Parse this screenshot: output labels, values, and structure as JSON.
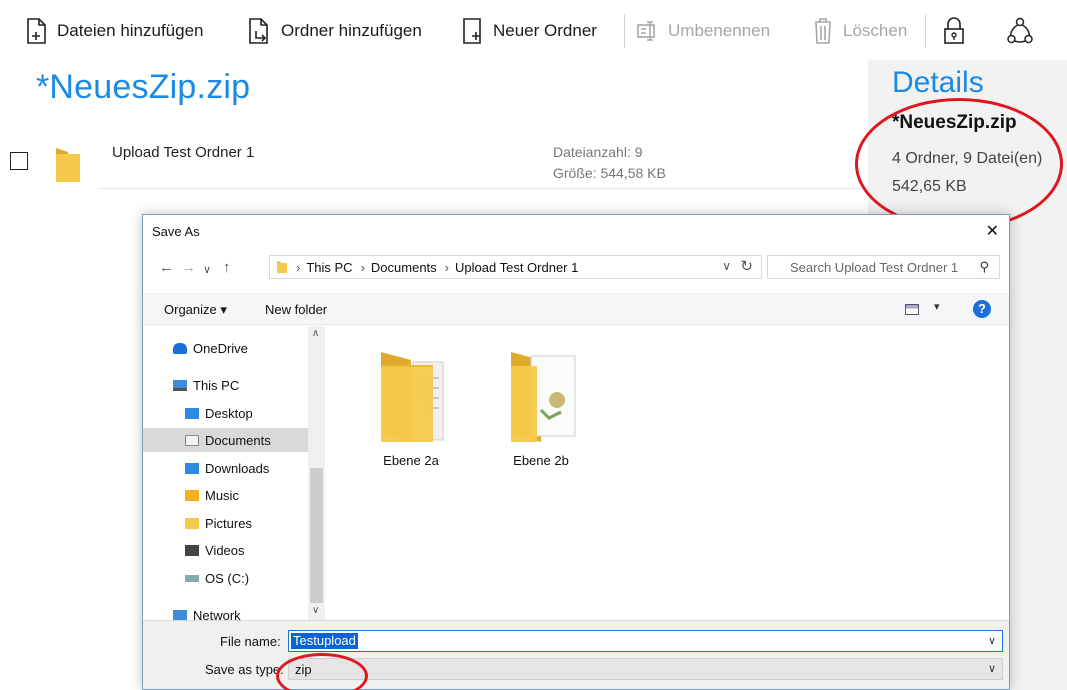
{
  "toolbar": {
    "add_files": "Dateien hinzufügen",
    "add_folder": "Ordner hinzufügen",
    "new_folder": "Neuer Ordner",
    "rename": "Umbenennen",
    "delete": "Löschen"
  },
  "main": {
    "title": "*NeuesZip.zip",
    "rows": [
      {
        "name": "Upload Test Ordner 1",
        "count": "Dateianzahl: 9",
        "size": "Größe: 544,58 KB"
      }
    ]
  },
  "details": {
    "title": "Details",
    "name": "*NeuesZip.zip",
    "info": "4 Ordner, 9 Datei(en)",
    "size": "542,65 KB"
  },
  "dialog": {
    "title": "Save As",
    "close": "✕",
    "address": {
      "breadcrumbs": [
        "This PC",
        "Documents",
        "Upload Test Ordner 1"
      ]
    },
    "search_placeholder": "Search Upload Test Ordner 1",
    "organize": "Organize ▾",
    "new_folder": "New folder",
    "nav": [
      {
        "label": "OneDrive",
        "icon": "cloud-icon"
      },
      {
        "label": "This PC",
        "icon": "computer-icon"
      },
      {
        "label": "Desktop",
        "icon": "desktop-icon"
      },
      {
        "label": "Documents",
        "icon": "documents-icon",
        "selected": true
      },
      {
        "label": "Downloads",
        "icon": "downloads-icon"
      },
      {
        "label": "Music",
        "icon": "music-icon"
      },
      {
        "label": "Pictures",
        "icon": "pictures-icon"
      },
      {
        "label": "Videos",
        "icon": "videos-icon"
      },
      {
        "label": "OS (C:)",
        "icon": "drive-icon"
      },
      {
        "label": "Network",
        "icon": "network-icon"
      }
    ],
    "files": [
      {
        "name": "Ebene 2a"
      },
      {
        "name": "Ebene 2b"
      }
    ],
    "file_name_label": "File name:",
    "file_name_value": "Testupload",
    "save_type_label": "Save as type:",
    "save_type_value": "zip"
  },
  "colors": {
    "accent": "#1a8ae6",
    "annotation": "#e0161f",
    "selection": "#0a64d6",
    "folder": "#f5c94a"
  }
}
